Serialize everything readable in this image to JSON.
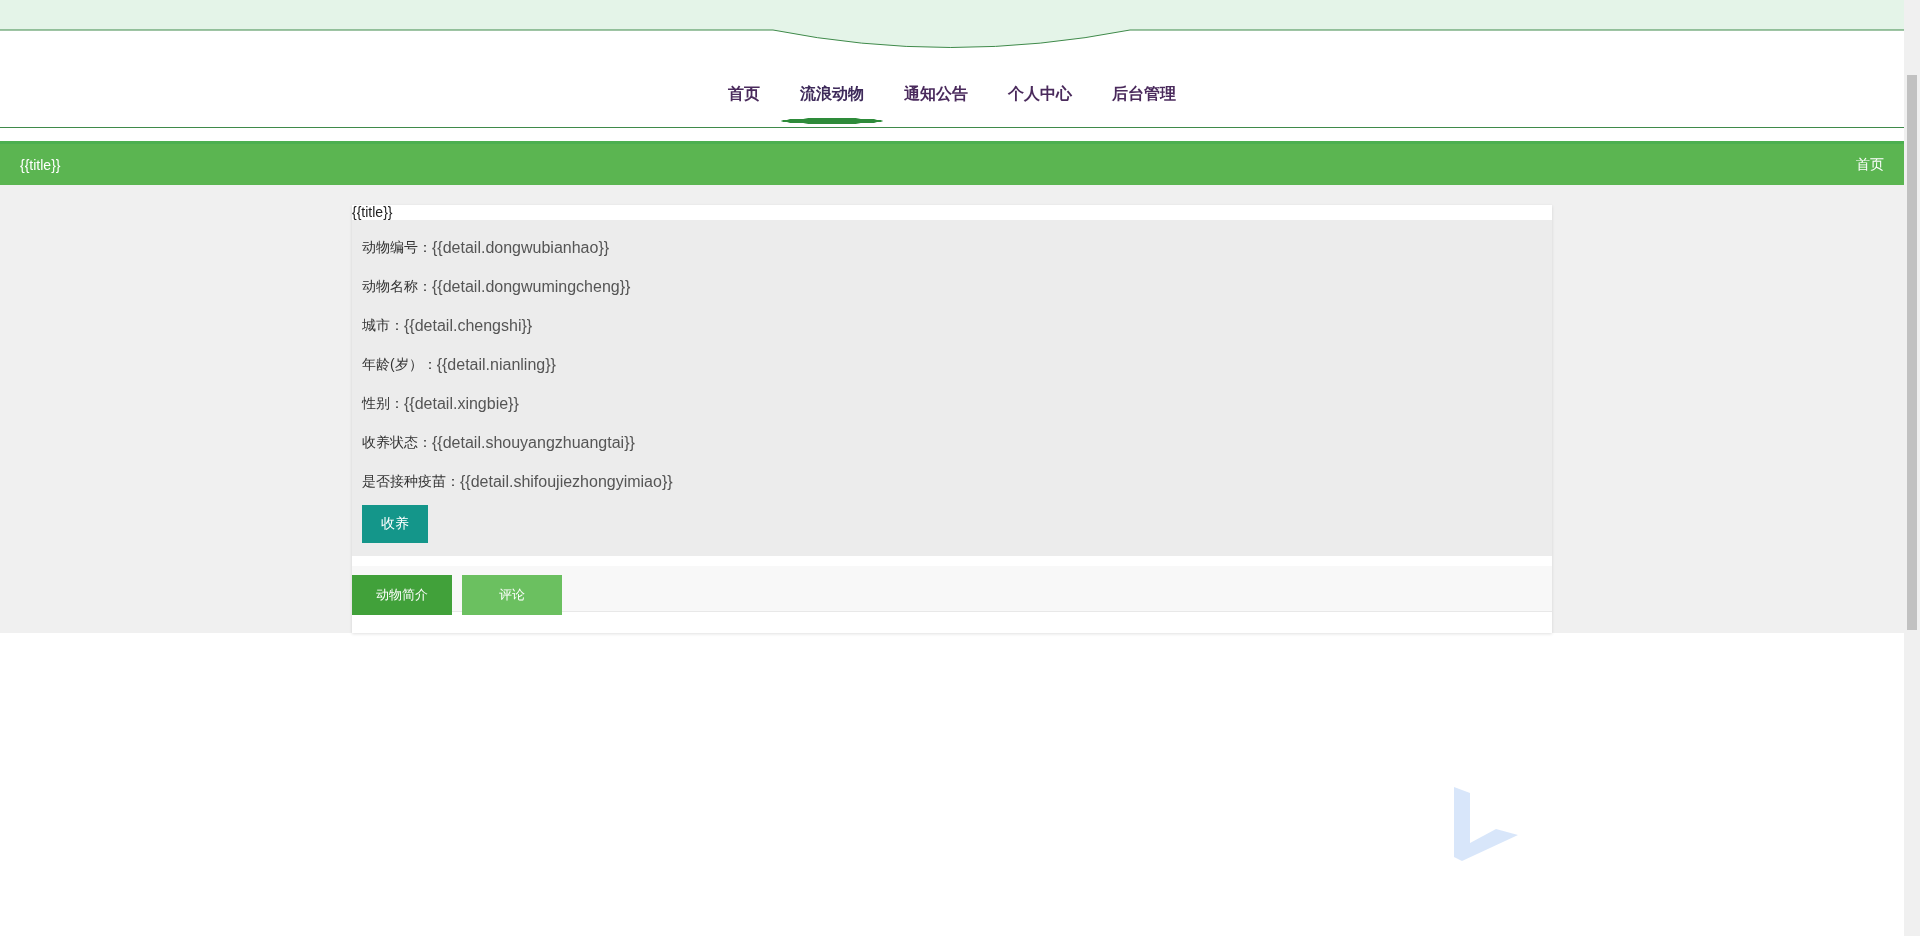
{
  "nav": [
    {
      "label": "首页",
      "selected": false
    },
    {
      "label": "流浪动物",
      "selected": true
    },
    {
      "label": "通知公告",
      "selected": false
    },
    {
      "label": "个人中心",
      "selected": false
    },
    {
      "label": "后台管理",
      "selected": false
    }
  ],
  "title_bar": {
    "title": "{{title}}",
    "link": "首页"
  },
  "detail": {
    "title": "{{title}}",
    "fields": [
      {
        "label": "动物编号：",
        "value": "{{detail.dongwubianhao}}"
      },
      {
        "label": "动物名称：",
        "value": "{{detail.dongwumingcheng}}"
      },
      {
        "label": "城市：",
        "value": "{{detail.chengshi}}"
      },
      {
        "label": "年龄(岁）：",
        "value": "{{detail.nianling}}"
      },
      {
        "label": "性别：",
        "value": "{{detail.xingbie}}"
      },
      {
        "label": "收养状态：",
        "value": "{{detail.shouyangzhuangtai}}"
      },
      {
        "label": "是否接种疫苗：",
        "value": "{{detail.shifoujiezhongyimiao}}"
      }
    ],
    "button": "收养"
  },
  "tabs": [
    {
      "label": "动物简介",
      "selected": true
    },
    {
      "label": "评论",
      "selected": false
    }
  ]
}
